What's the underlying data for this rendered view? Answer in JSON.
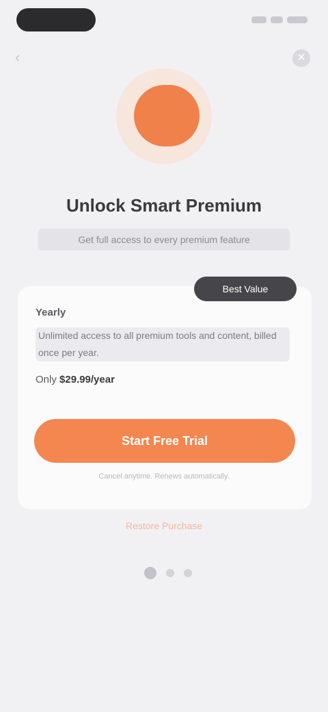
{
  "nav": {
    "back_label": "‹",
    "close_label": "✕"
  },
  "hero": {
    "title": "Unlock Smart Premium",
    "subtitle": "Get full access to every premium feature"
  },
  "plan": {
    "badge": "Best Value",
    "name": "Yearly",
    "description": "Unlimited access to all premium tools and content, billed once per year.",
    "price_prefix": "Only",
    "price": "$29.99/year"
  },
  "cta": {
    "label": "Start Free Trial",
    "note": "Cancel anytime. Renews automatically."
  },
  "footer": {
    "restore_label": "Restore Purchase",
    "pages": [
      {
        "active": true
      },
      {
        "active": false
      },
      {
        "active": false
      }
    ]
  },
  "colors": {
    "accent": "#f4864f",
    "background": "#f1f1f4",
    "card": "#fbfbfc",
    "badge": "#46464a"
  }
}
